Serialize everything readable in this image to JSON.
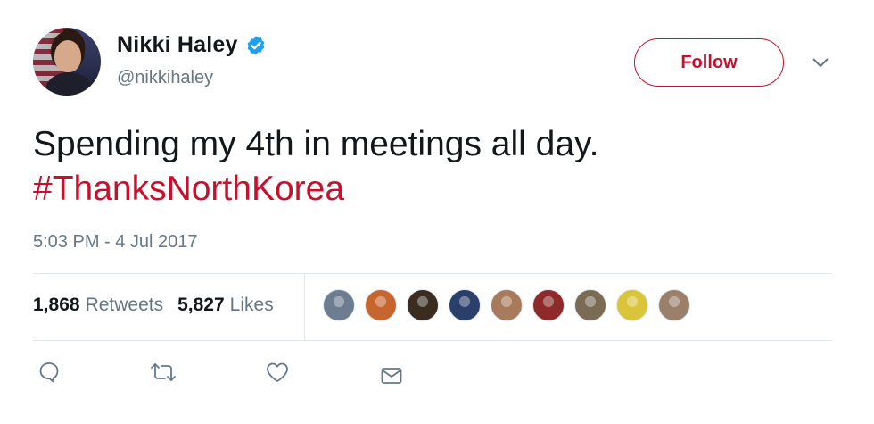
{
  "user": {
    "name": "Nikki Haley",
    "handle": "@nikkihaley",
    "verified": true,
    "avatar_icon": "profile-photo"
  },
  "follow_label": "Follow",
  "tweet": {
    "text": "Spending my 4th in meetings all day.",
    "hashtag": "#ThanksNorthKorea",
    "timestamp": "5:03 PM - 4 Jul 2017"
  },
  "stats": {
    "retweets_count": "1,868",
    "retweets_label": "Retweets",
    "likes_count": "5,827",
    "likes_label": "Likes"
  },
  "likers": [
    {
      "icon": "liker-avatar",
      "color": "#6d7c8f"
    },
    {
      "icon": "liker-avatar",
      "color": "#c7652e"
    },
    {
      "icon": "liker-avatar",
      "color": "#3a2c1f"
    },
    {
      "icon": "liker-avatar",
      "color": "#2b3f6b"
    },
    {
      "icon": "liker-avatar",
      "color": "#a87a5c"
    },
    {
      "icon": "liker-avatar",
      "color": "#8e2a2a"
    },
    {
      "icon": "liker-avatar",
      "color": "#7a6b55"
    },
    {
      "icon": "liker-avatar",
      "color": "#d9c43a"
    },
    {
      "icon": "liker-avatar",
      "color": "#9a7f6a"
    }
  ],
  "actions": [
    "reply-icon",
    "retweet-icon",
    "like-icon",
    "direct-message-icon"
  ],
  "colors": {
    "accent": "#c8102e",
    "text": "#14171a",
    "muted": "#657786",
    "verified": "#1da1f2",
    "divider": "#e1e8ed"
  }
}
